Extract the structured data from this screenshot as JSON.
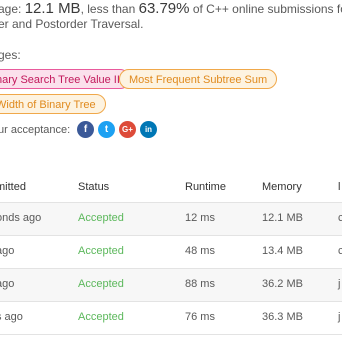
{
  "memory_summary": {
    "prefix": "age: ",
    "memory_value": "12.1 MB",
    "middle": ", less than ",
    "percent": "63.79%",
    "suffix": " of C++ online submissions for Construct B",
    "line2": "er and Postorder Traversal."
  },
  "similar": {
    "label": "ges:",
    "tags": [
      {
        "label": "nary Search Tree Value II",
        "color": "pink"
      },
      {
        "label": "Most Frequent Subtree Sum",
        "color": "orange"
      },
      {
        "label": "Width of Binary Tree",
        "color": "orange"
      }
    ]
  },
  "share": {
    "label": "ur acceptance:",
    "icons": [
      {
        "name": "facebook-icon",
        "glyph": "f",
        "color": "#3b5998"
      },
      {
        "name": "twitter-icon",
        "glyph": "t",
        "color": "#1da1f2"
      },
      {
        "name": "googleplus-icon",
        "glyph": "G+",
        "color": "#dd4b39"
      },
      {
        "name": "linkedin-icon",
        "glyph": "in",
        "color": "#0077b5"
      }
    ]
  },
  "table": {
    "headers": [
      "mitted",
      "Status",
      "Runtime",
      "Memory",
      "l"
    ],
    "rows": [
      {
        "submitted": "onds ago",
        "status": "Accepted",
        "runtime": "12 ms",
        "memory": "12.1 MB",
        "lang": "c"
      },
      {
        "submitted": "ago",
        "status": "Accepted",
        "runtime": "48 ms",
        "memory": "13.4 MB",
        "lang": "c"
      },
      {
        "submitted": "ago",
        "status": "Accepted",
        "runtime": "88 ms",
        "memory": "36.2 MB",
        "lang": "j"
      },
      {
        "submitted": "s ago",
        "status": "Accepted",
        "runtime": "76 ms",
        "memory": "36.3 MB",
        "lang": "j"
      }
    ],
    "accepted_color": "#5cb85c"
  }
}
